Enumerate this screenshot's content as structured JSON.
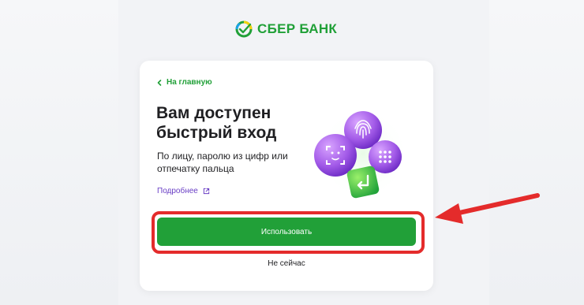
{
  "header": {
    "brand_name": "СБЕР БАНК",
    "brand_color": "#21a038"
  },
  "card": {
    "back_label": "На главную",
    "title": "Вам доступен быстрый вход",
    "subtitle": "По лицу, паролю из цифр или отпечатку пальца",
    "more_label": "Подробнее",
    "primary_button_label": "Использовать",
    "secondary_label": "Не сейчас"
  },
  "illustration": {
    "icons": [
      "face-id-icon",
      "fingerprint-icon",
      "keypad-icon",
      "enter-key-icon"
    ]
  },
  "colors": {
    "accent_green": "#21a038",
    "link_purple": "#6a3fc5",
    "highlight_red": "#e42b2b"
  }
}
